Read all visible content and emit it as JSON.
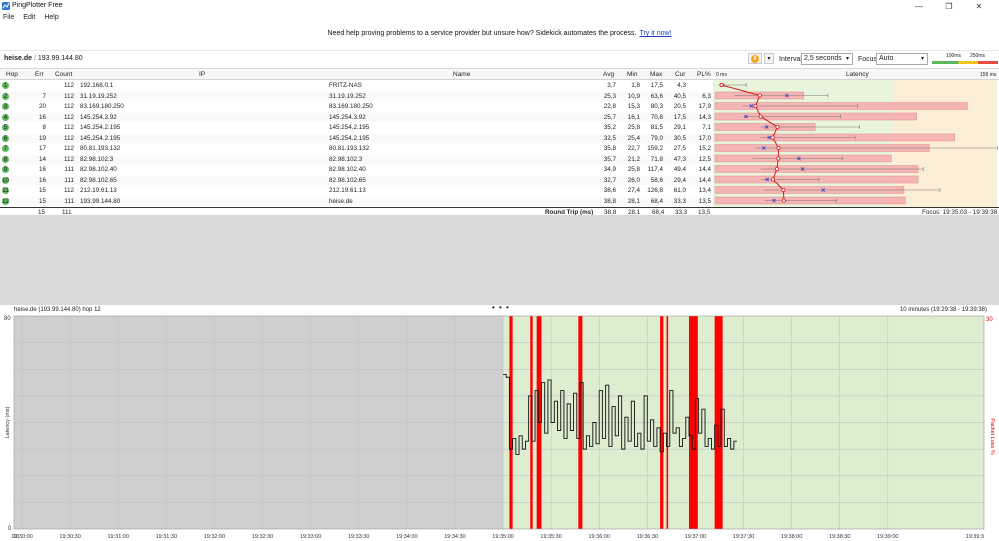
{
  "window": {
    "title": "PingPlotter Free",
    "controls": [
      "—",
      "❐",
      "✕"
    ]
  },
  "menu": [
    "File",
    "Edit",
    "Help"
  ],
  "banner": {
    "text": "Need help proving problems to a service provider but unsure how? Sidekick automates the process.",
    "link": "Try it now!"
  },
  "toolbar": {
    "target_host": "heise.de",
    "target_sep": "/",
    "target_ip": "193.99.144.80",
    "interval_label": "Interval",
    "interval_value": "2,5 seconds",
    "focus_label": "Focus",
    "focus_value": "Auto",
    "scale_low": "100ms",
    "scale_high": "250ms"
  },
  "grid": {
    "columns": {
      "hop": "Hop",
      "err": "Err",
      "count": "Count",
      "ip": "IP",
      "name": "Name",
      "avg": "Avg",
      "min": "Min",
      "max": "Max",
      "cur": "Cur",
      "pl": "PL%",
      "latency": "Latency"
    },
    "latency_scale_left": "0 ms",
    "latency_scale_right": "159 ms",
    "rows": [
      {
        "hop": "1",
        "err": "",
        "count": "112",
        "ip": "192.168.0.1",
        "name": "FRITZ-NAS",
        "avg": "3,7",
        "min": "1,8",
        "max": "17,5",
        "cur": "4,3",
        "pl": ""
      },
      {
        "hop": "2",
        "err": "7",
        "count": "112",
        "ip": "31.19.19.252",
        "name": "31.19.19.252",
        "avg": "25,3",
        "min": "10,9",
        "max": "63,6",
        "cur": "40,5",
        "pl": "6,3"
      },
      {
        "hop": "3",
        "err": "20",
        "count": "112",
        "ip": "83.169.180.250",
        "name": "83.169.180.250",
        "avg": "22,8",
        "min": "15,3",
        "max": "80,3",
        "cur": "20,5",
        "pl": "17,9"
      },
      {
        "hop": "4",
        "err": "16",
        "count": "112",
        "ip": "145.254.3.92",
        "name": "145.254.3.92",
        "avg": "25,7",
        "min": "16,1",
        "max": "70,8",
        "cur": "17,5",
        "pl": "14,3"
      },
      {
        "hop": "5",
        "err": "8",
        "count": "112",
        "ip": "145.254.2.195",
        "name": "145.254.2.195",
        "avg": "35,2",
        "min": "25,8",
        "max": "81,5",
        "cur": "29,1",
        "pl": "7,1"
      },
      {
        "hop": "6",
        "err": "19",
        "count": "112",
        "ip": "145.254.2.195",
        "name": "145.254.2.195",
        "avg": "32,5",
        "min": "25,4",
        "max": "79,0",
        "cur": "30,5",
        "pl": "17,0"
      },
      {
        "hop": "7",
        "err": "17",
        "count": "112",
        "ip": "80.81.193.132",
        "name": "80.81.193.132",
        "avg": "35,8",
        "min": "22,7",
        "max": "159,2",
        "cur": "27,5",
        "pl": "15,2"
      },
      {
        "hop": "8",
        "err": "14",
        "count": "112",
        "ip": "82.98.102.3",
        "name": "82.98.102.3",
        "avg": "35,7",
        "min": "21,2",
        "max": "71,8",
        "cur": "47,3",
        "pl": "12,5"
      },
      {
        "hop": "9",
        "err": "16",
        "count": "111",
        "ip": "82.98.102.40",
        "name": "82.98.102.40",
        "avg": "34,9",
        "min": "25,8",
        "max": "117,4",
        "cur": "49,4",
        "pl": "14,4"
      },
      {
        "hop": "10",
        "err": "16",
        "count": "111",
        "ip": "82.98.102.65",
        "name": "82.98.102.65",
        "avg": "32,7",
        "min": "26,0",
        "max": "58,6",
        "cur": "29,4",
        "pl": "14,4"
      },
      {
        "hop": "11",
        "err": "15",
        "count": "112",
        "ip": "212.19.61.13",
        "name": "212.19.61.13",
        "avg": "38,6",
        "min": "27,4",
        "max": "126,8",
        "cur": "61,0",
        "pl": "13,4"
      },
      {
        "hop": "12",
        "err": "15",
        "count": "111",
        "ip": "193.99.144.80",
        "name": "heise.de",
        "avg": "38,8",
        "min": "28,1",
        "max": "68,4",
        "cur": "33,3",
        "pl": "13,5"
      }
    ],
    "round_trip": {
      "err": "15",
      "count": "111",
      "label": "Round Trip (ms)",
      "avg": "38,8",
      "min": "28,1",
      "max": "68,4",
      "cur": "33,3",
      "pl": "13,5"
    },
    "focus_range": "Focus: 19:35:03 - 19:39:38"
  },
  "timeline": {
    "title": "heise.de (193.99.144.80) hop 12",
    "range": "10 minutes (19:29:38 - 19:39:38)",
    "dots": "• • •"
  },
  "chart_data": {
    "type": "line",
    "title": "",
    "ylabel": "Latency (ms)",
    "y2label": "Packet Loss %",
    "ylim": [
      0,
      80
    ],
    "y2max": "30",
    "y_ticks": [
      "80",
      "0"
    ],
    "x_ticks": [
      "19:30:00",
      "19:30:30",
      "19:31:00",
      "19:31:30",
      "19:32:00",
      "19:32:30",
      "19:33:00",
      "19:33:30",
      "19:34:00",
      "19:34:30",
      "19:35:00",
      "19:35:30",
      "19:36:00",
      "19:36:30",
      "19:37:00",
      "19:37:30",
      "19:38:00",
      "19:38:30",
      "19:39:00"
    ],
    "x_tick_seconds": [
      0,
      30,
      60,
      90,
      120,
      150,
      180,
      210,
      240,
      270,
      300,
      330,
      360,
      390,
      420,
      450,
      480,
      510,
      540
    ],
    "x_first_label": "10",
    "x_last_label": "19:39:3",
    "data_start_seconds": 300,
    "loss_bars_seconds": [
      [
        304,
        306
      ],
      [
        317,
        318.5
      ],
      [
        321,
        324
      ],
      [
        347,
        349.5
      ],
      [
        398,
        400
      ],
      [
        402,
        403
      ],
      [
        416,
        421.5
      ],
      [
        432,
        437
      ]
    ],
    "latency_series": [
      [
        300,
        58
      ],
      [
        302,
        57
      ],
      [
        304,
        30
      ],
      [
        306,
        34
      ],
      [
        308,
        28
      ],
      [
        310,
        35
      ],
      [
        312,
        30
      ],
      [
        314,
        33
      ],
      [
        316,
        50
      ],
      [
        318,
        33
      ],
      [
        320,
        52
      ],
      [
        322,
        40
      ],
      [
        324,
        55
      ],
      [
        326,
        36
      ],
      [
        328,
        56
      ],
      [
        330,
        40
      ],
      [
        332,
        48
      ],
      [
        334,
        37
      ],
      [
        336,
        52
      ],
      [
        338,
        34
      ],
      [
        340,
        47
      ],
      [
        342,
        37
      ],
      [
        344,
        51
      ],
      [
        346,
        34
      ],
      [
        348,
        55
      ],
      [
        350,
        30
      ],
      [
        352,
        35
      ],
      [
        354,
        31
      ],
      [
        356,
        40
      ],
      [
        358,
        32
      ],
      [
        360,
        52
      ],
      [
        362,
        34
      ],
      [
        364,
        54
      ],
      [
        366,
        31
      ],
      [
        368,
        46
      ],
      [
        370,
        35
      ],
      [
        372,
        50
      ],
      [
        374,
        30
      ],
      [
        376,
        42
      ],
      [
        378,
        33
      ],
      [
        380,
        48
      ],
      [
        382,
        31
      ],
      [
        384,
        36
      ],
      [
        386,
        30
      ],
      [
        388,
        50
      ],
      [
        390,
        33
      ],
      [
        392,
        41
      ],
      [
        394,
        31
      ],
      [
        396,
        38
      ],
      [
        398,
        29
      ],
      [
        400,
        36
      ],
      [
        402,
        31
      ],
      [
        404,
        52
      ],
      [
        406,
        36
      ],
      [
        408,
        38
      ],
      [
        410,
        31
      ],
      [
        412,
        34
      ],
      [
        414,
        42
      ],
      [
        416,
        35
      ],
      [
        418,
        30
      ],
      [
        420,
        49
      ],
      [
        422,
        36
      ],
      [
        424,
        45
      ],
      [
        426,
        31
      ],
      [
        428,
        34
      ],
      [
        430,
        30
      ],
      [
        432,
        39
      ],
      [
        434,
        31
      ],
      [
        436,
        45
      ],
      [
        438,
        31
      ],
      [
        440,
        34
      ],
      [
        442,
        30
      ],
      [
        444,
        33
      ]
    ]
  }
}
